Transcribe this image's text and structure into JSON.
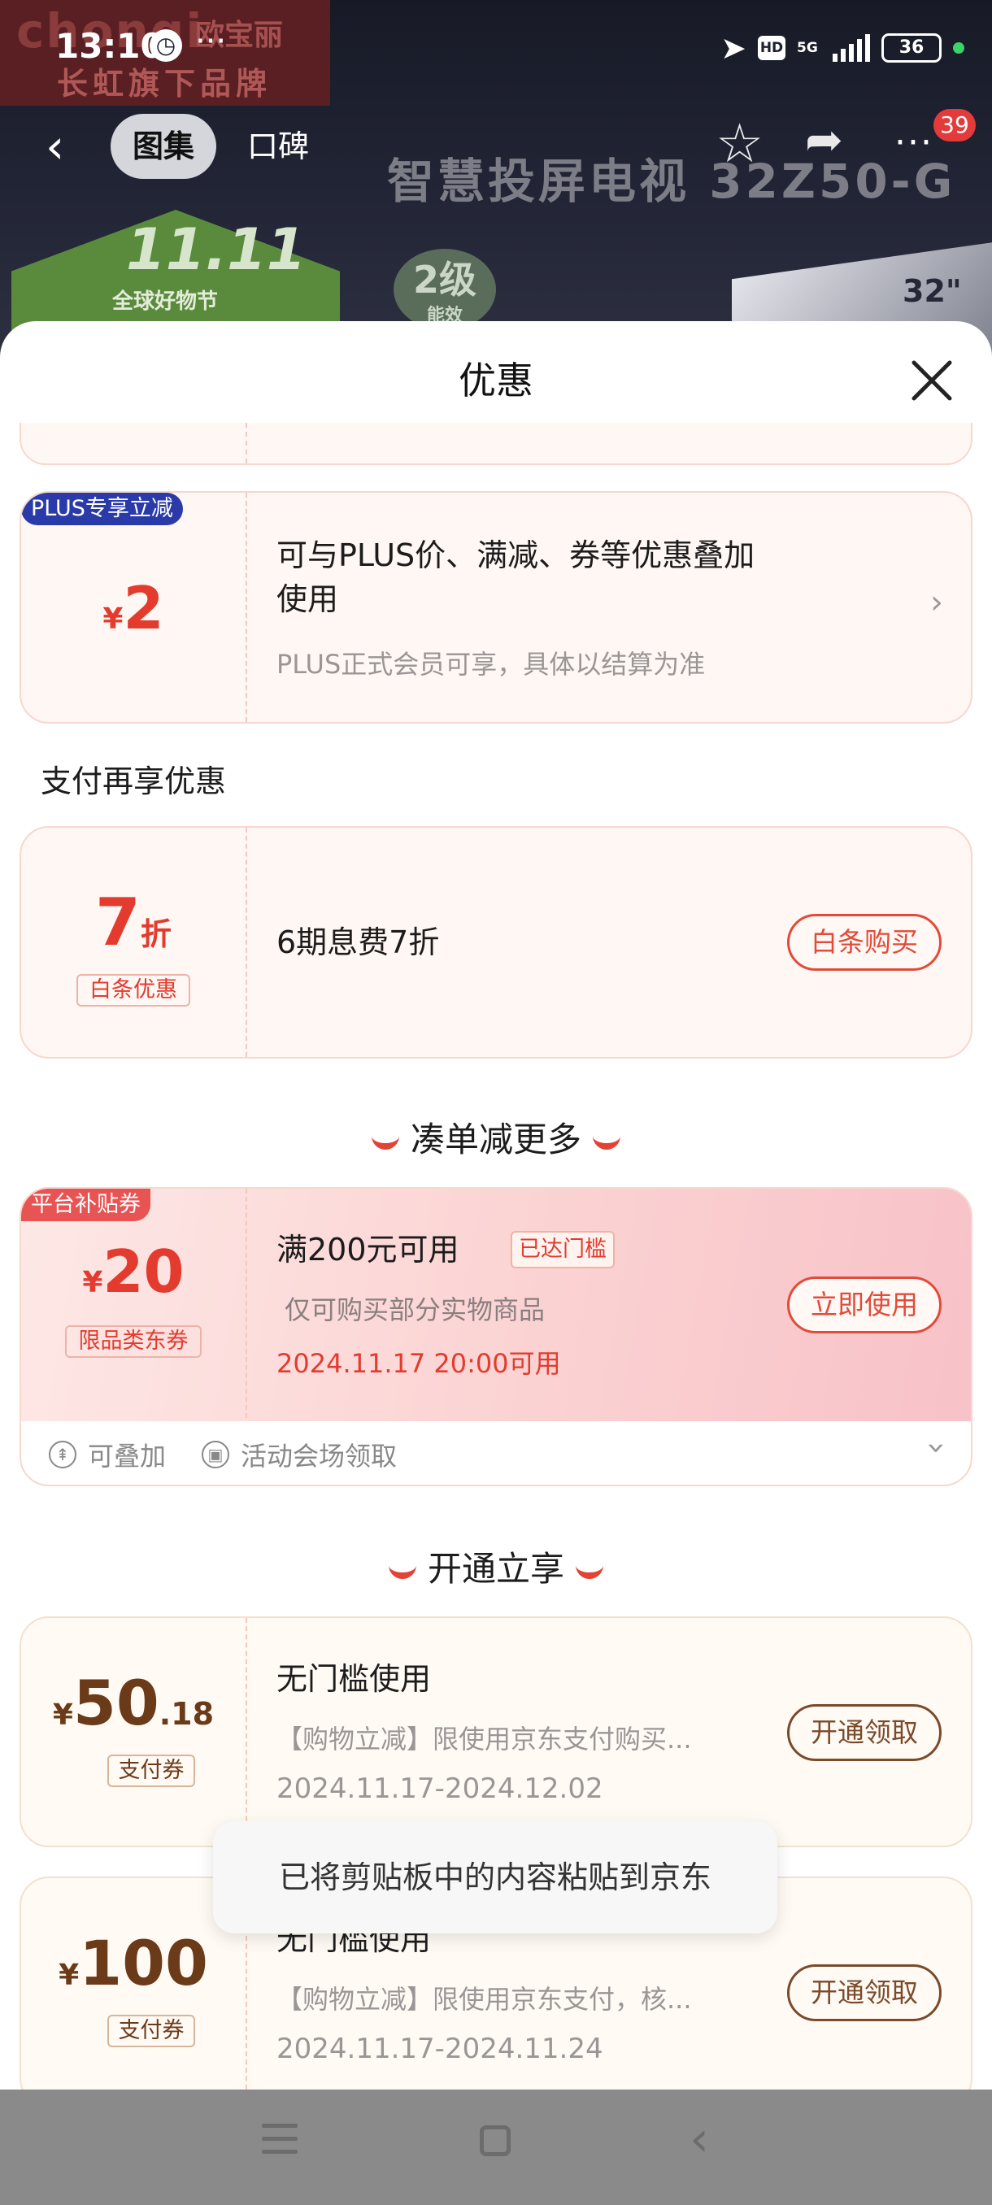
{
  "status": {
    "time": "13:10",
    "network": "5G",
    "hd": "HD",
    "battery": "36"
  },
  "brand": {
    "logo_en": "chongi",
    "logo_cn": "欧宝丽",
    "subtitle": "长虹旗下品牌"
  },
  "header": {
    "tab_gallery": "图集",
    "tab_reviews": "口碑",
    "badge": "39"
  },
  "hero": {
    "title": "智慧投屏电视 32Z50-G",
    "festival_num": "11.11",
    "festival_text": "全球好物节",
    "energy_level": "2级",
    "energy_label": "能效",
    "screen": "32\""
  },
  "sheet": {
    "title": "优惠"
  },
  "plus_card": {
    "tag": "PLUS专享立减",
    "currency": "¥",
    "amount": "2",
    "line1": "可与PLUS价、满减、券等优惠叠加",
    "line2": "使用",
    "note": "PLUS正式会员可享，具体以结算为准"
  },
  "pay_section": {
    "title": "支付再享优惠"
  },
  "baitiao_card": {
    "discount": "7",
    "unit": "折",
    "tag": "白条优惠",
    "desc": "6期息费7折",
    "button": "白条购买"
  },
  "combo_section": {
    "title": "凑单减更多"
  },
  "platform_card": {
    "tag": "平台补贴券",
    "currency": "¥",
    "amount": "20",
    "type": "限品类东券",
    "title": "满200元可用",
    "reached": "已达门槛",
    "desc": "仅可购买部分实物商品",
    "time": "2024.11.17 20:00可用",
    "button": "立即使用",
    "stack": "可叠加",
    "source": "活动会场领取"
  },
  "open_section": {
    "title": "开通立享"
  },
  "coupon1": {
    "currency": "¥",
    "amount": "50",
    "decimal": ".18",
    "tag": "支付券",
    "title": "无门槛使用",
    "desc": "【购物立减】限使用京东支付购买...",
    "date": "2024.11.17-2024.12.02",
    "button": "开通领取"
  },
  "coupon2": {
    "currency": "¥",
    "amount": "100",
    "tag": "支付券",
    "title": "无门槛使用",
    "desc": "【购物立减】限使用京东支付，核...",
    "date": "2024.11.17-2024.11.24",
    "button": "开通领取"
  },
  "toast": {
    "text": "已将剪贴板中的内容粘贴到京东"
  }
}
